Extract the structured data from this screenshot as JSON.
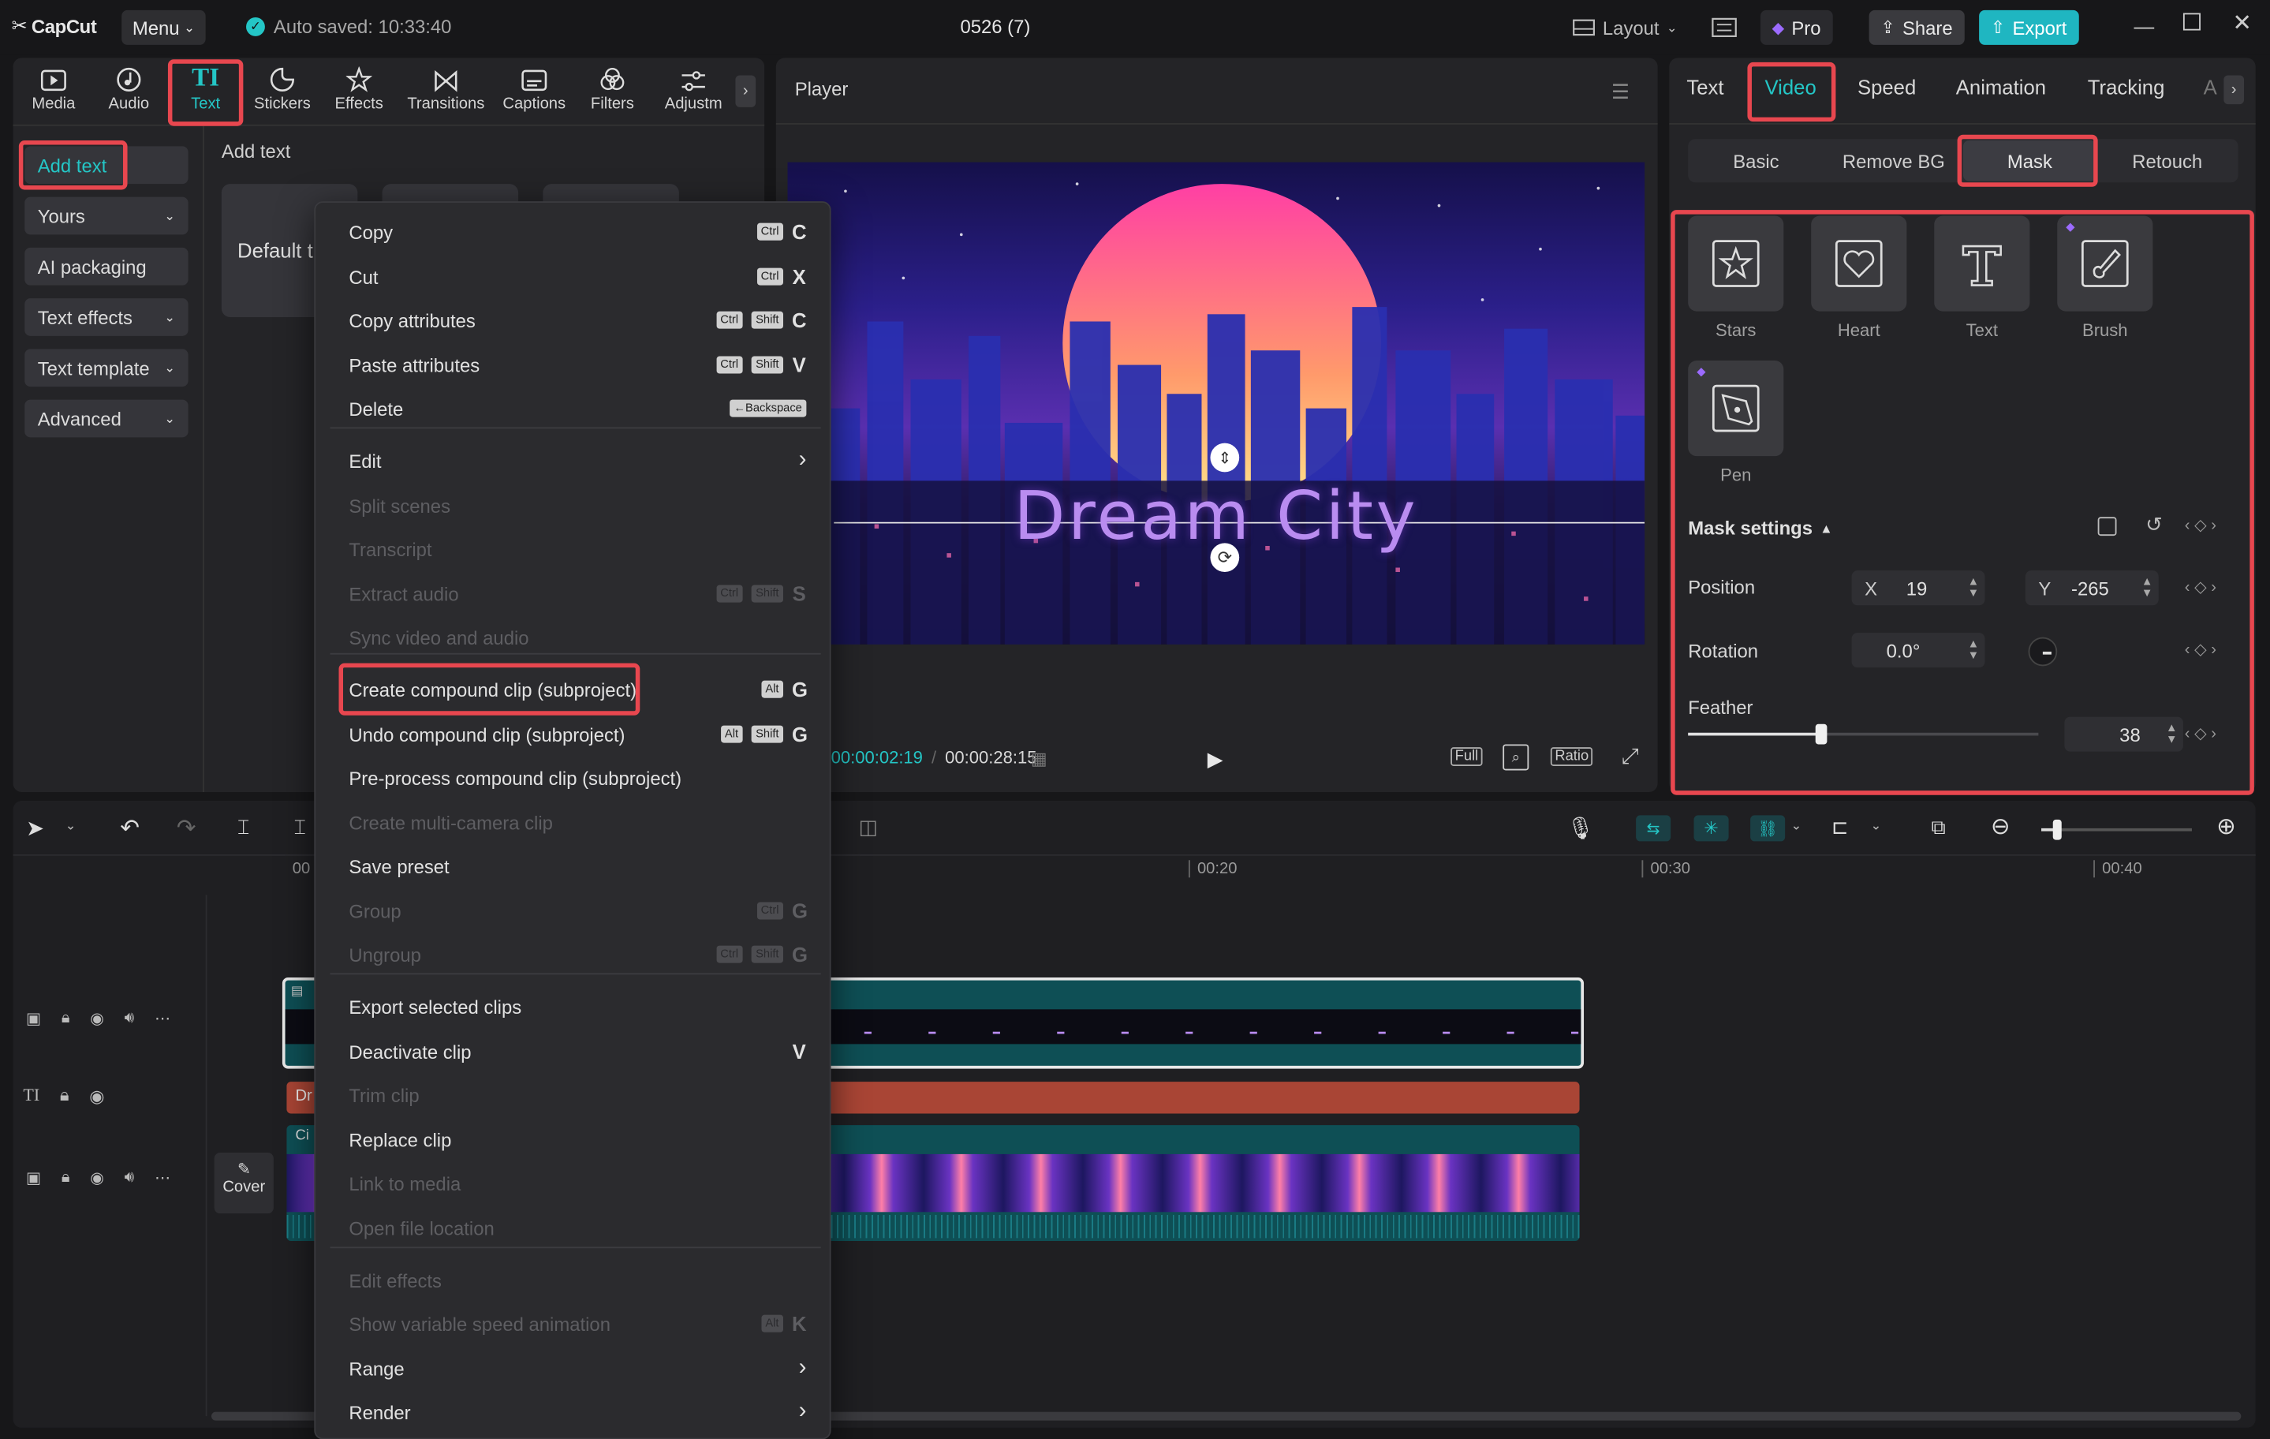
{
  "titlebar": {
    "logo": "CapCut",
    "menu": "Menu",
    "autosave": "Auto saved: 10:33:40",
    "project": "0526 (7)",
    "layout": "Layout",
    "pro": "Pro",
    "share": "Share",
    "export": "Export"
  },
  "media_tabs": [
    {
      "label": "Media",
      "icon": "media-icon"
    },
    {
      "label": "Audio",
      "icon": "audio-icon"
    },
    {
      "label": "Text",
      "icon": "text-icon"
    },
    {
      "label": "Stickers",
      "icon": "stickers-icon"
    },
    {
      "label": "Effects",
      "icon": "effects-icon"
    },
    {
      "label": "Transitions",
      "icon": "transitions-icon"
    },
    {
      "label": "Captions",
      "icon": "captions-icon"
    },
    {
      "label": "Filters",
      "icon": "filters-icon"
    },
    {
      "label": "Adjustm",
      "icon": "adjustment-icon"
    }
  ],
  "left_sidebar": {
    "add_text": "Add text",
    "yours": "Yours",
    "ai_packaging": "AI packaging",
    "text_effects": "Text effects",
    "text_template": "Text template",
    "advanced": "Advanced"
  },
  "text_panel": {
    "heading": "Add text",
    "default_card": "Default t"
  },
  "context_menu": {
    "items": [
      {
        "label": "Copy",
        "keys": [
          "Ctrl"
        ],
        "letter": "C",
        "disabled": false
      },
      {
        "label": "Cut",
        "keys": [
          "Ctrl"
        ],
        "letter": "X",
        "disabled": false
      },
      {
        "label": "Copy attributes",
        "keys": [
          "Ctrl",
          "Shift"
        ],
        "letter": "C",
        "disabled": false
      },
      {
        "label": "Paste attributes",
        "keys": [
          "Ctrl",
          "Shift"
        ],
        "letter": "V",
        "disabled": false
      },
      {
        "label": "Delete",
        "keys": [
          "←Backspace"
        ],
        "letter": "",
        "disabled": false
      },
      {
        "label": "Edit",
        "submenu": true,
        "disabled": false
      },
      {
        "label": "Split scenes",
        "disabled": true
      },
      {
        "label": "Transcript",
        "disabled": true
      },
      {
        "label": "Extract audio",
        "keys": [
          "Ctrl",
          "Shift"
        ],
        "letter": "S",
        "disabled": true
      },
      {
        "label": "Sync video and audio",
        "disabled": true
      },
      {
        "label": "Create compound clip (subproject)",
        "keys": [
          "Alt"
        ],
        "letter": "G",
        "disabled": false
      },
      {
        "label": "Undo compound clip (subproject)",
        "keys": [
          "Alt",
          "Shift"
        ],
        "letter": "G",
        "disabled": false
      },
      {
        "label": "Pre-process compound clip (subproject)",
        "disabled": false
      },
      {
        "label": "Create multi-camera clip",
        "disabled": true
      },
      {
        "label": "Save preset",
        "disabled": false
      },
      {
        "label": "Group",
        "keys": [
          "Ctrl"
        ],
        "letter": "G",
        "disabled": true
      },
      {
        "label": "Ungroup",
        "keys": [
          "Ctrl",
          "Shift"
        ],
        "letter": "G",
        "disabled": true
      },
      {
        "label": "Export selected clips",
        "disabled": false
      },
      {
        "label": "Deactivate clip",
        "keys": [],
        "letter": "V",
        "disabled": false
      },
      {
        "label": "Trim clip",
        "disabled": true
      },
      {
        "label": "Replace clip",
        "disabled": false
      },
      {
        "label": "Link to media",
        "disabled": true
      },
      {
        "label": "Open file location",
        "disabled": true
      },
      {
        "label": "Edit effects",
        "disabled": true
      },
      {
        "label": "Show variable speed animation",
        "keys": [
          "Alt"
        ],
        "letter": "K",
        "disabled": true
      },
      {
        "label": "Range",
        "submenu": true,
        "disabled": false
      },
      {
        "label": "Render",
        "submenu": true,
        "disabled": false
      }
    ]
  },
  "player": {
    "title": "Player",
    "overlay_text": "Dream City",
    "current_time": "00:00:02:19",
    "total_time": "00:00:28:15",
    "full": "Full",
    "ratio": "Ratio"
  },
  "properties": {
    "tabs": [
      "Text",
      "Video",
      "Speed",
      "Animation",
      "Tracking",
      "A"
    ],
    "subtabs": [
      "Basic",
      "Remove BG",
      "Mask",
      "Retouch"
    ],
    "masks": [
      {
        "label": "Stars",
        "icon": "star-mask-icon"
      },
      {
        "label": "Heart",
        "icon": "heart-mask-icon"
      },
      {
        "label": "Text",
        "icon": "text-mask-icon"
      },
      {
        "label": "Brush",
        "icon": "brush-mask-icon"
      },
      {
        "label": "Pen",
        "icon": "pen-mask-icon"
      }
    ],
    "mask_settings": "Mask settings",
    "position_label": "Position",
    "x_label": "X",
    "x_value": "19",
    "y_label": "Y",
    "y_value": "-265",
    "rotation_label": "Rotation",
    "rotation_value": "0.0°",
    "feather_label": "Feather",
    "feather_value": "38",
    "feather_fraction": 0.38
  },
  "timeline": {
    "ticks": [
      "00",
      "00:20",
      "00:30",
      "00:40"
    ],
    "cover": "Cover",
    "text_clip": "Dr",
    "video_clip": "Ci"
  },
  "colors": {
    "accent": "#24c6c6",
    "highlight": "#e8474f",
    "text_clip": "#a94535",
    "video_clip": "#0e4f55"
  }
}
